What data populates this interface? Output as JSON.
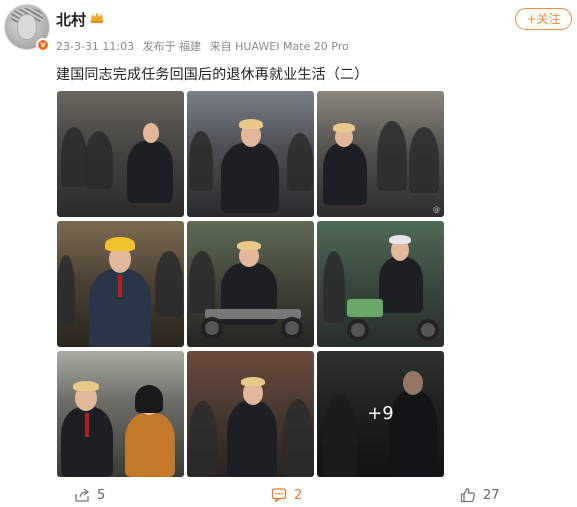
{
  "post": {
    "username": "北村",
    "date": "23-3-31 11:03",
    "location": "发布于 福建",
    "device": "来自 HUAWEI Mate 20 Pro",
    "follow_label": "+关注",
    "content": "建国同志完成任务回国后的退休再就业生活（二）",
    "images": {
      "more_label": "+9"
    },
    "actions": {
      "share_count": "5",
      "comment_count": "2",
      "like_count": "27"
    }
  },
  "icons": {
    "verify": "v-badge-icon",
    "crown": "crown-icon",
    "share": "share-icon",
    "comment": "comment-icon",
    "like": "thumbs-up-icon"
  },
  "colors": {
    "accent": "#f08a3c",
    "verify_badge": "#f26d21"
  }
}
